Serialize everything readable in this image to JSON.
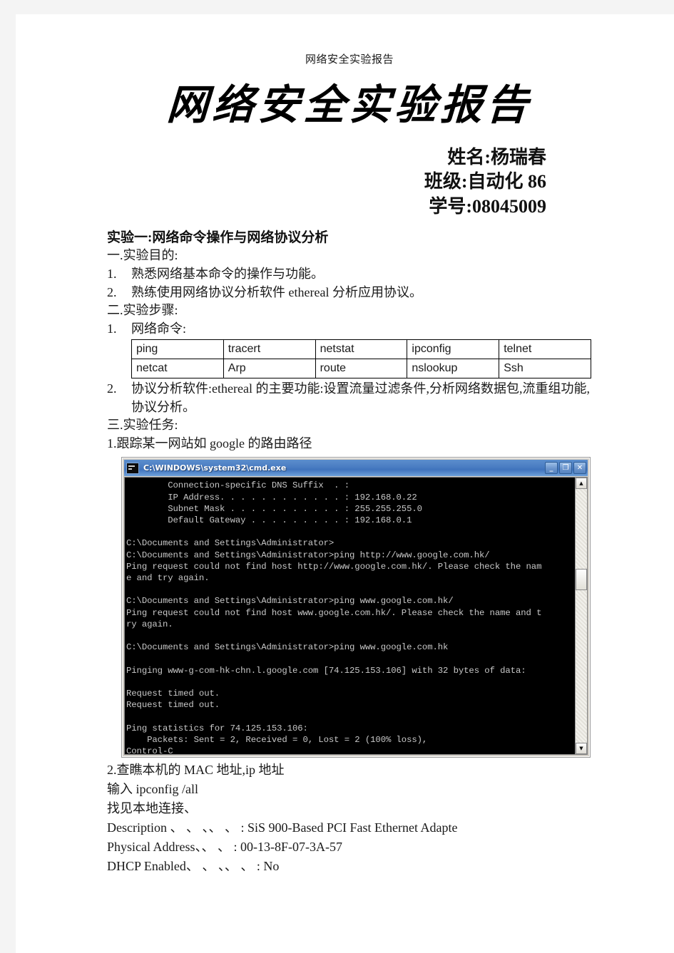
{
  "document": {
    "running_head": "网络安全实验报告",
    "title": "网络安全实验报告",
    "meta": {
      "name_line": "姓名:杨瑞春",
      "class_line": "班级:自动化 86",
      "id_line": "学号:08045009"
    },
    "experiment_heading": "实验一:网络命令操作与网络协议分析",
    "purpose_heading": "一.实验目的:",
    "purpose_items": [
      {
        "n": "1.",
        "text": "熟悉网络基本命令的操作与功能。"
      },
      {
        "n": "2.",
        "text": "熟练使用网络协议分析软件 ethereal 分析应用协议。"
      }
    ],
    "steps_heading": "二.实验步骤:",
    "steps_item_1": {
      "n": "1.",
      "text": "网络命令:"
    },
    "command_table": {
      "rows": [
        [
          "ping",
          "tracert",
          "netstat",
          "ipconfig",
          "telnet"
        ],
        [
          "netcat",
          "Arp",
          "route",
          "nslookup",
          "Ssh"
        ]
      ]
    },
    "steps_item_2": {
      "n": "2.",
      "text": "协议分析软件:ethereal 的主要功能:设置流量过滤条件,分析网络数据包,流重组功能,协议分析。"
    },
    "tasks_heading": "三.实验任务:",
    "task_1": "1.跟踪某一网站如 google 的路由路径",
    "task_2": "2.查瞧本机的 MAC 地址,ip 地址",
    "tail_lines": [
      "输入 ipconfig /all",
      "找见本地连接、",
      "Description 、 、 、、 、 : SiS 900-Based PCI Fast Ethernet Adapte",
      "Physical Address、、 、 : 00-13-8F-07-3A-57",
      "DHCP Enabled、 、 、、 、 : No"
    ]
  },
  "cmd_window": {
    "title": "C:\\WINDOWS\\system32\\cmd.exe",
    "buttons": {
      "minimize": "_",
      "maximize": "❐",
      "close": "✕"
    },
    "scrollbar": {
      "up": "▲",
      "down": "▼"
    },
    "console_text": "        Connection-specific DNS Suffix  . :\n        IP Address. . . . . . . . . . . . : 192.168.0.22\n        Subnet Mask . . . . . . . . . . . : 255.255.255.0\n        Default Gateway . . . . . . . . . : 192.168.0.1\n\nC:\\Documents and Settings\\Administrator>\nC:\\Documents and Settings\\Administrator>ping http://www.google.com.hk/\nPing request could not find host http://www.google.com.hk/. Please check the nam\ne and try again.\n\nC:\\Documents and Settings\\Administrator>ping www.google.com.hk/\nPing request could not find host www.google.com.hk/. Please check the name and t\nry again.\n\nC:\\Documents and Settings\\Administrator>ping www.google.com.hk\n\nPinging www-g-com-hk-chn.l.google.com [74.125.153.106] with 32 bytes of data:\n\nRequest timed out.\nRequest timed out.\n\nPing statistics for 74.125.153.106:\n    Packets: Sent = 2, Received = 0, Lost = 2 (100% loss),\nControl-C\n^C"
  }
}
